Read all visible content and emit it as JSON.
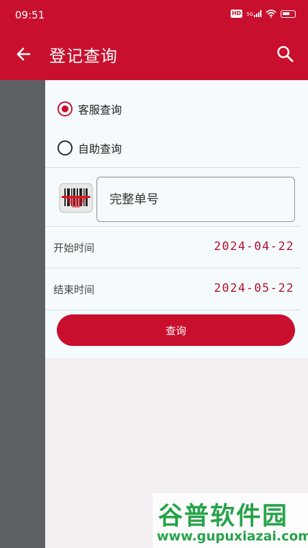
{
  "status_bar": {
    "time": "09:51",
    "hd": "HD",
    "signal": "5G",
    "icons": [
      "hd-icon",
      "signal-icon",
      "wifi-icon",
      "battery-icon"
    ]
  },
  "header": {
    "title": "登记查询",
    "back_icon": "arrow-left-icon",
    "search_icon": "search-icon",
    "color": "#c8102e"
  },
  "query_type": {
    "options": [
      {
        "label": "客服查询",
        "selected": true
      },
      {
        "label": "自助查询",
        "selected": false
      }
    ]
  },
  "order_input": {
    "placeholder": "完整单号",
    "value": "",
    "scan_icon": "barcode-scan-icon"
  },
  "start_date": {
    "label": "开始时间",
    "value": "2024-04-22"
  },
  "end_date": {
    "label": "结束时间",
    "value": "2024-05-22"
  },
  "submit_label": "查询",
  "watermark": {
    "line1": "谷普软件园",
    "line2": "www.gupuxiazai.com"
  },
  "colors": {
    "accent": "#c8102e",
    "sidebar": "#5d6163",
    "panel": "#f5fbfd",
    "background": "#f2eef1"
  }
}
